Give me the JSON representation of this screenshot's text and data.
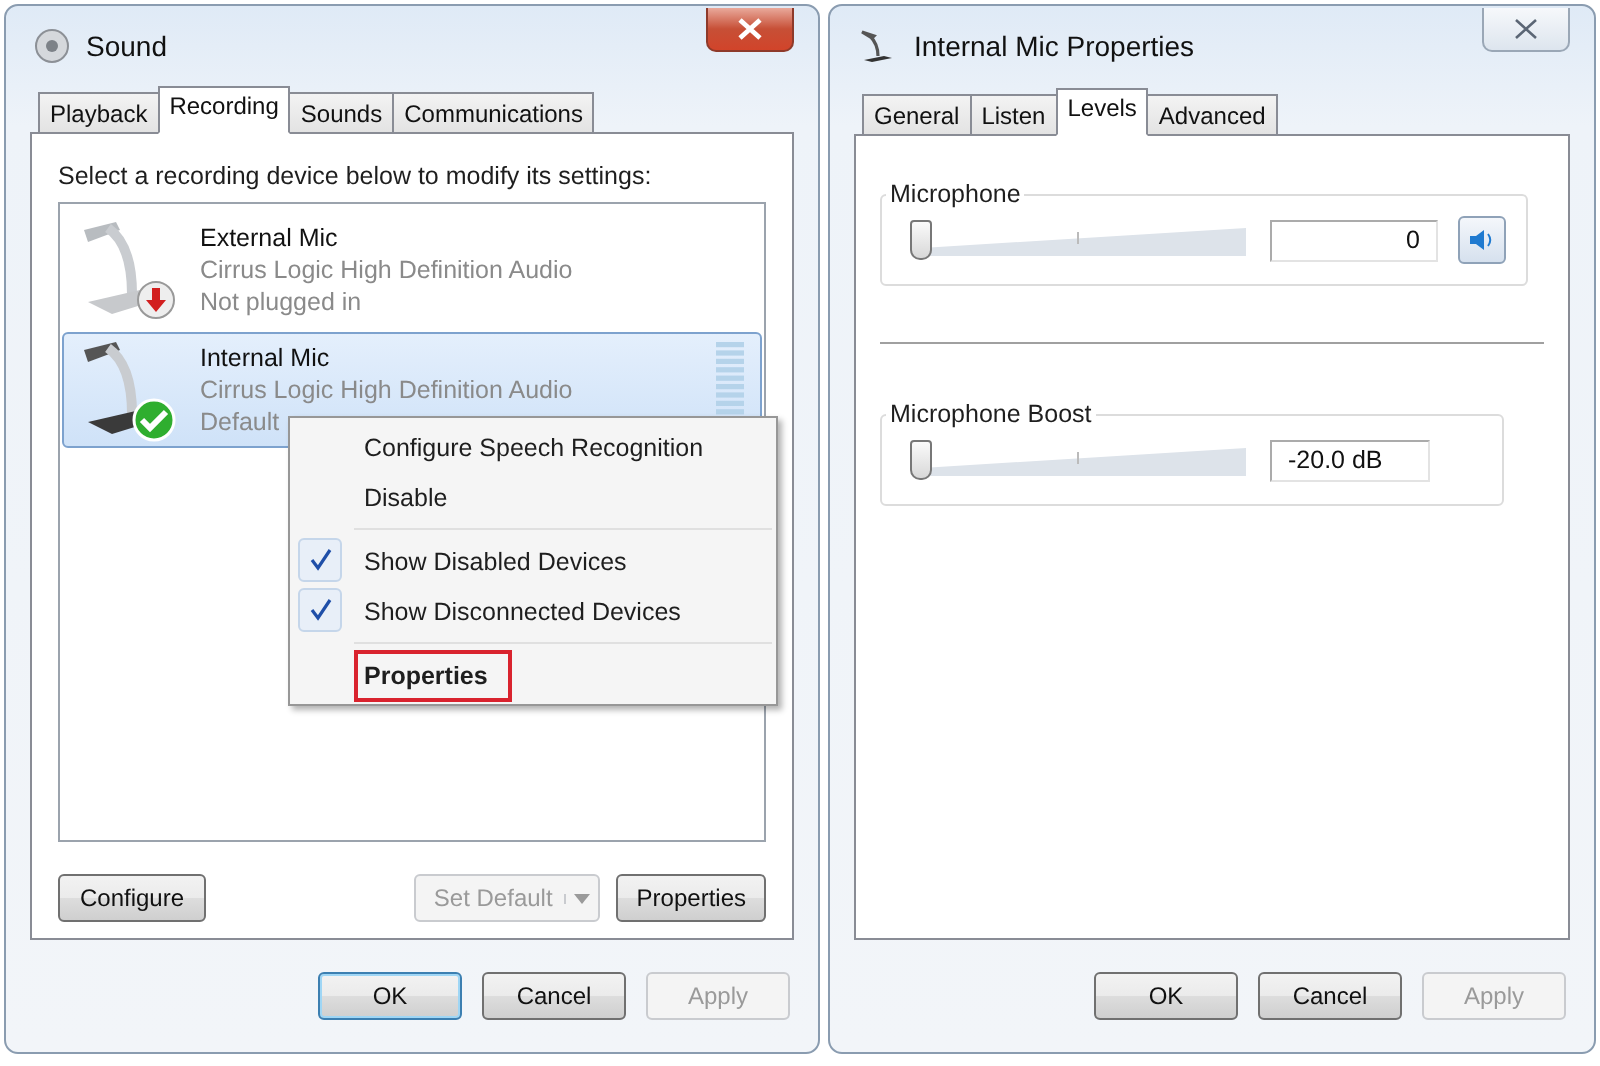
{
  "sound_dialog": {
    "title": "Sound",
    "tabs": [
      {
        "label": "Playback",
        "selected": false
      },
      {
        "label": "Recording",
        "selected": true
      },
      {
        "label": "Sounds",
        "selected": false
      },
      {
        "label": "Communications",
        "selected": false
      }
    ],
    "instruction": "Select a recording device below to modify its settings:",
    "devices": [
      {
        "name": "External Mic",
        "driver": "Cirrus Logic High Definition Audio",
        "status": "Not plugged in",
        "kind": "unplugged",
        "selected": false
      },
      {
        "name": "Internal Mic",
        "driver": "Cirrus Logic High Definition Audio",
        "status": "Default",
        "kind": "default",
        "selected": true
      }
    ],
    "context_menu": [
      {
        "kind": "item",
        "label": "Configure Speech Recognition",
        "checked": false,
        "bold": false,
        "outlined": false
      },
      {
        "kind": "item",
        "label": "Disable",
        "checked": false,
        "bold": false,
        "outlined": false
      },
      {
        "kind": "separator"
      },
      {
        "kind": "item",
        "label": "Show Disabled Devices",
        "checked": true,
        "bold": false,
        "outlined": false
      },
      {
        "kind": "item",
        "label": "Show Disconnected Devices",
        "checked": true,
        "bold": false,
        "outlined": false
      },
      {
        "kind": "separator"
      },
      {
        "kind": "item",
        "label": "Properties",
        "checked": false,
        "bold": true,
        "outlined": true
      }
    ],
    "panel_buttons": [
      {
        "kind": "button",
        "label": "Configure",
        "disabled": false
      },
      {
        "kind": "split",
        "label": "Set Default",
        "disabled": true
      },
      {
        "kind": "button",
        "label": "Properties",
        "disabled": false
      }
    ],
    "footer_buttons": [
      {
        "label": "OK",
        "default": true,
        "disabled": false
      },
      {
        "label": "Cancel",
        "default": false,
        "disabled": false
      },
      {
        "label": "Apply",
        "default": false,
        "disabled": true
      }
    ]
  },
  "properties_dialog": {
    "title": "Internal Mic Properties",
    "tabs": [
      {
        "label": "General",
        "selected": false
      },
      {
        "label": "Listen",
        "selected": false
      },
      {
        "label": "Levels",
        "selected": true
      },
      {
        "label": "Advanced",
        "selected": false
      }
    ],
    "groups": [
      {
        "kind": "volume",
        "label": "Microphone",
        "level": 0,
        "value": "0"
      },
      {
        "kind": "boost",
        "label": "Microphone Boost",
        "level": 0,
        "value": "-20.0 dB"
      }
    ],
    "footer_buttons": [
      {
        "label": "OK",
        "default": false,
        "disabled": false
      },
      {
        "label": "Cancel",
        "default": false,
        "disabled": false
      },
      {
        "label": "Apply",
        "default": false,
        "disabled": true
      }
    ]
  }
}
